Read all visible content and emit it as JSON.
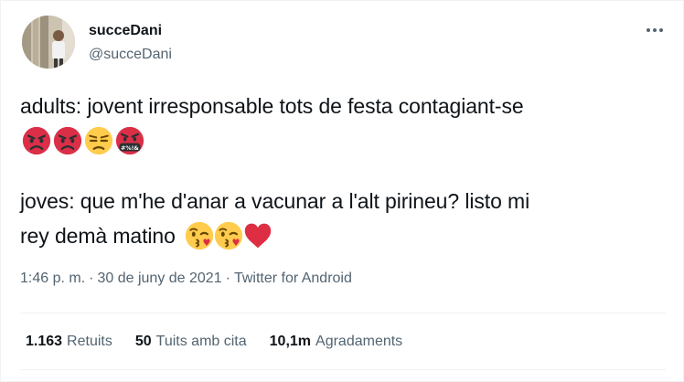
{
  "user": {
    "display_name": "succeDani",
    "handle": "@succeDani"
  },
  "tweet": {
    "line1": "adults: jovent irresponsable tots de festa contagiant-se",
    "line1_emojis": [
      "pouting-face",
      "pouting-face",
      "unamused-face",
      "face-with-symbols-on-mouth"
    ],
    "line2": "joves: que m'he d'anar a vacunar a l'alt pirineu? listo mi",
    "line3": "rey demà matino",
    "line3_emojis": [
      "face-blowing-a-kiss",
      "face-blowing-a-kiss",
      "red-heart"
    ]
  },
  "meta": {
    "time": "1:46 p. m.",
    "sep1": "·",
    "date": "30 de juny de 2021",
    "sep2": "·",
    "source": "Twitter for Android"
  },
  "stats": {
    "retweets_count": "1.163",
    "retweets_label": "Retuits",
    "quotes_count": "50",
    "quotes_label": "Tuits amb cita",
    "likes_count": "10,1m",
    "likes_label": "Agradaments"
  },
  "colors": {
    "text": "#0f1419",
    "secondary": "#536471",
    "divider": "#eff3f4",
    "angry_red": "#da2f47",
    "emoji_yellow": "#ffcc4d",
    "heart_red": "#dd2e44"
  }
}
